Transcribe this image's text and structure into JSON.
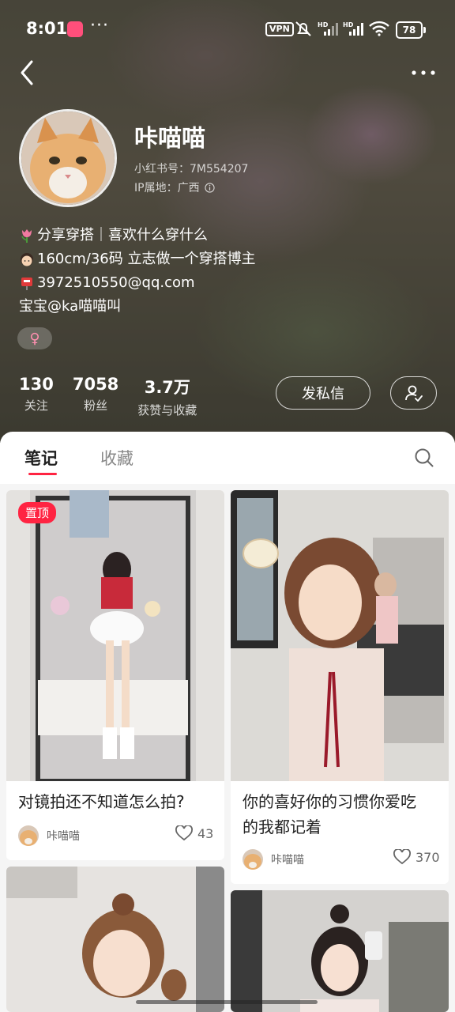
{
  "status_bar": {
    "time": "8:01",
    "dots": "···",
    "vpn": "VPN",
    "battery": "78"
  },
  "profile": {
    "nickname": "咔喵喵",
    "id_line": "小红书号：7M554207",
    "ip_line": "IP属地：广西",
    "bio": [
      {
        "icon": "tulip-icon",
        "text": "分享穿搭｜喜欢什么穿什么"
      },
      {
        "icon": "girl-face-icon",
        "text": "160cm/36码 立志做一个穿搭博主"
      },
      {
        "icon": "mailbox-icon",
        "text": "3972510550@qq.com"
      },
      {
        "icon": "",
        "text": "宝宝@ka喵喵叫"
      }
    ],
    "gender_symbol": "♀",
    "stats": [
      {
        "num": "130",
        "label": "关注"
      },
      {
        "num": "7058",
        "label": "粉丝"
      },
      {
        "num": "3.7万",
        "label": "获赞与收藏"
      }
    ],
    "message_button": "发私信"
  },
  "tabs": [
    {
      "label": "笔记",
      "active": true
    },
    {
      "label": "收藏",
      "active": false
    }
  ],
  "notes": [
    {
      "pinned_label": "置顶",
      "title_lines": [
        "对镜拍还不知道怎么拍?"
      ],
      "author": "咔喵喵",
      "likes": "43"
    },
    {
      "pinned_label": "",
      "title_lines": [
        "你的喜好你的习惯你爱吃",
        "的我都记着"
      ],
      "author": "咔喵喵",
      "likes": "370"
    },
    {
      "pinned_label": "",
      "title_lines": [],
      "author": "",
      "likes": ""
    },
    {
      "pinned_label": "",
      "title_lines": [],
      "author": "",
      "likes": ""
    }
  ],
  "colors": {
    "accent": "#ff2442",
    "header_overlay": "#4c4a3c"
  }
}
